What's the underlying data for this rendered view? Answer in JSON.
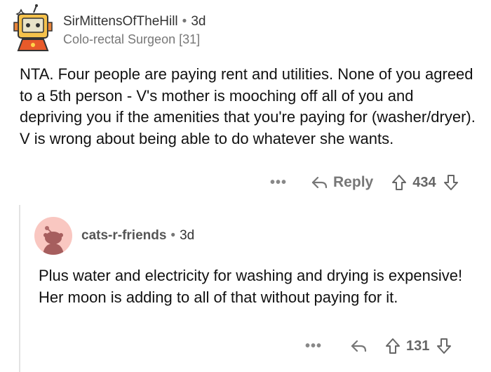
{
  "comment": {
    "username": "SirMittensOfTheHill",
    "separator": "•",
    "age": "3d",
    "flair": "Colo-rectal Surgeon [31]",
    "body": "NTA. Four people are paying rent and utilities. None of you agreed to a 5th person - V's mother is mooching off all of you and depriving you if the amenities that you're paying for (washer/dryer). V is wrong about being able to do whatever she wants.",
    "more": "•••",
    "reply_label": "Reply",
    "votes": "434"
  },
  "reply": {
    "username": "cats-r-friends",
    "separator": "•",
    "age": "3d",
    "body": "Plus water and electricity for washing and drying is expensive! Her moon is adding to all of that without paying for it.",
    "more": "•••",
    "votes": "131"
  },
  "colors": {
    "avatar_bg": "#f9c7c1",
    "thread_line": "#e3e3e3",
    "muted": "#777777"
  }
}
